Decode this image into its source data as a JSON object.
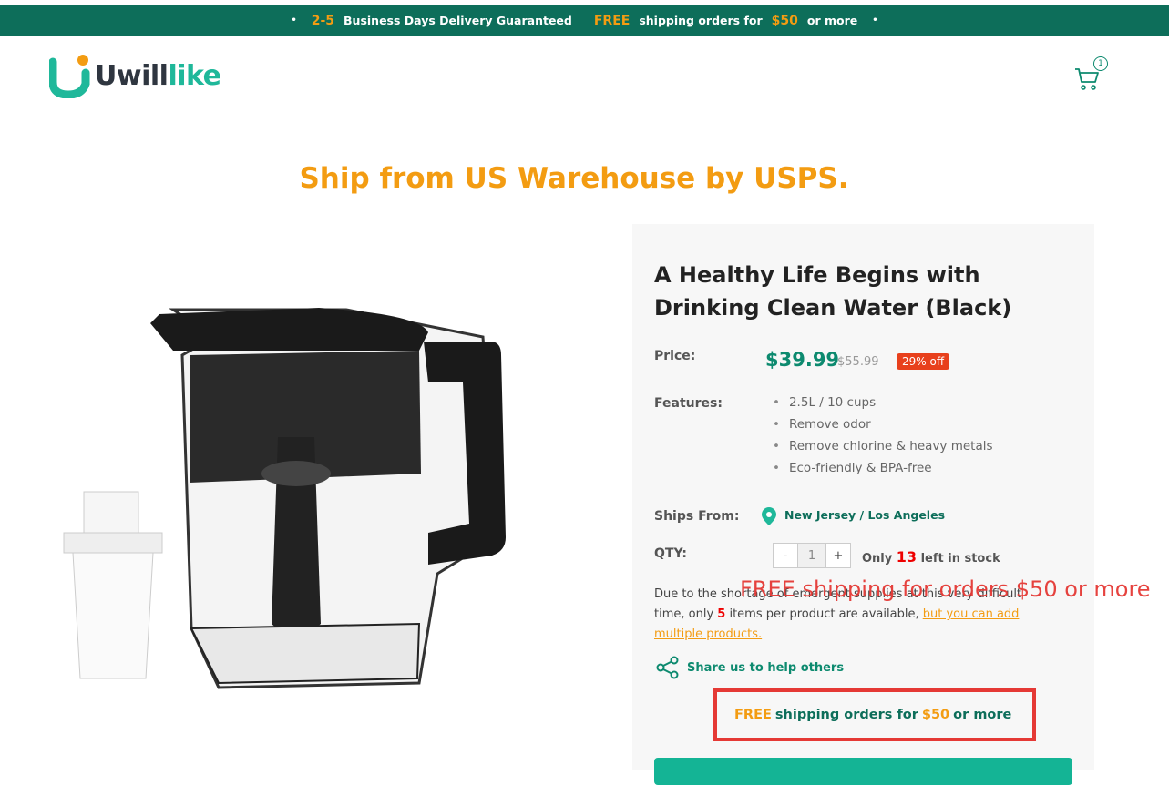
{
  "topbar": {
    "days": "2-5",
    "delivery": "Business Days Delivery Guaranteed",
    "free": "FREE",
    "shipping": "shipping orders for",
    "amount": "$50",
    "or_more": "or more",
    "bullet": "•"
  },
  "logo": {
    "uwill": "Uwill",
    "like": "like"
  },
  "cart": {
    "count": "1"
  },
  "ship_heading": "Ship from US Warehouse by USPS.",
  "product": {
    "title": "A Healthy Life Begins with Drinking Clean Water (Black)",
    "price_label": "Price:",
    "price": "$39.99",
    "old_price": "$55.99",
    "discount": "29% off",
    "features_label": "Features:",
    "features": [
      "2.5L / 10 cups",
      "Remove odor",
      "Remove chlorine & heavy metals",
      "Eco-friendly & BPA-free"
    ],
    "ships_label": "Ships From:",
    "ships_from": "New Jersey / Los Angeles",
    "qty_label": "QTY:",
    "qty_minus": "-",
    "qty_value": "1",
    "qty_plus": "+",
    "stock_pre": "Only",
    "stock_num": "13",
    "stock_post": "left in stock",
    "notice_1": "Due to the shortage of emergent supplies at this very difficult time, only",
    "notice_num": "5",
    "notice_2": "items per product are available,",
    "notice_link": "but you can add multiple products.",
    "overlay": "FREE shipping for orders $50 or more",
    "share": "Share us to help others",
    "free_box": {
      "free": "FREE",
      "shipping": "shipping orders for",
      "amount": "$50",
      "or_more": "or more"
    }
  },
  "colors": {
    "brand": "#0d6e5a",
    "accent": "#f39c12",
    "red": "#e53935",
    "teal": "#14b495"
  }
}
